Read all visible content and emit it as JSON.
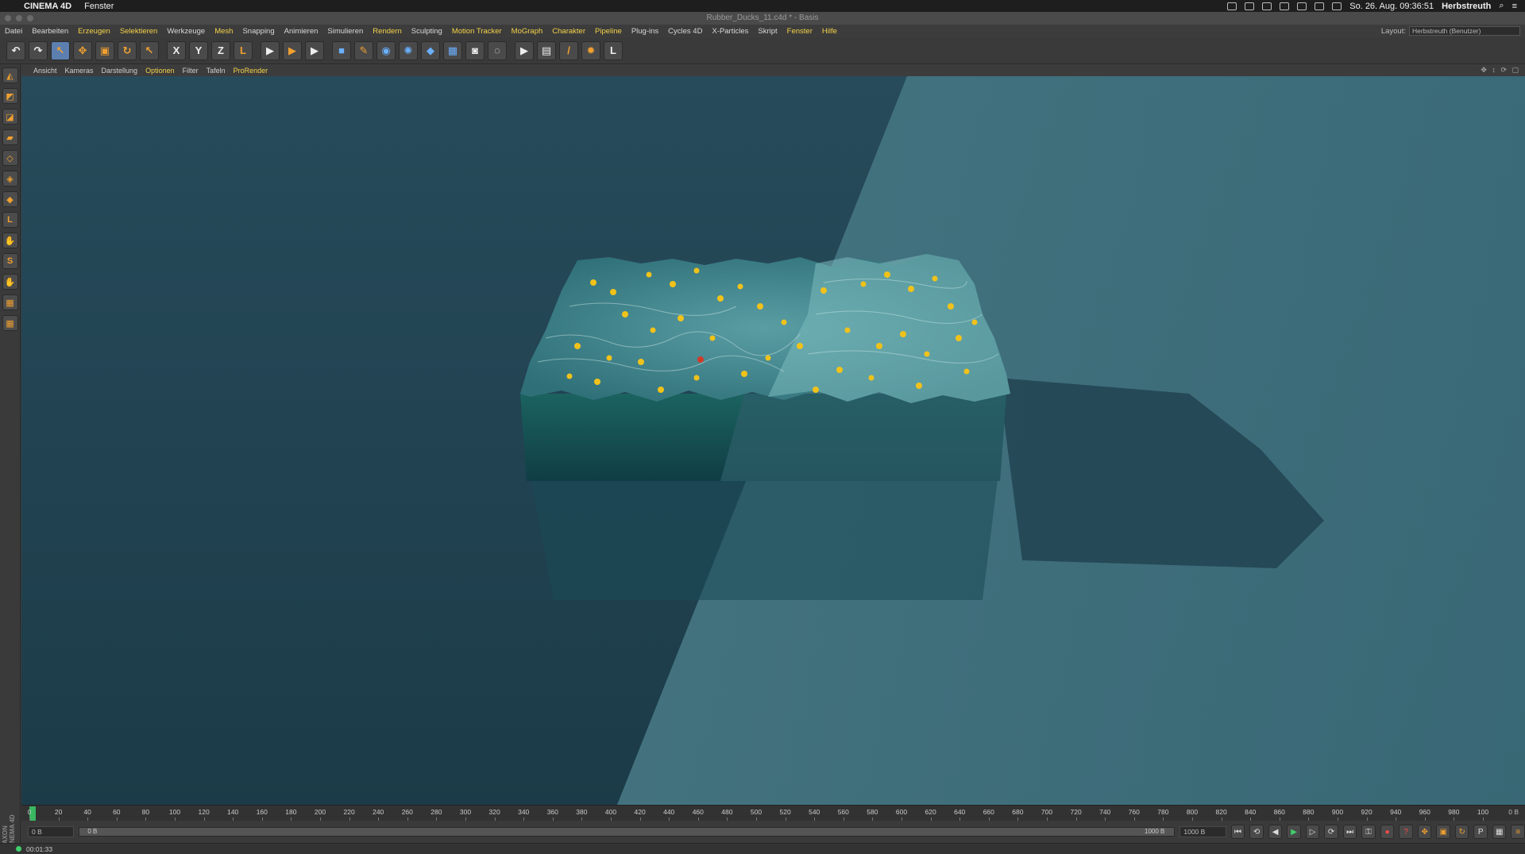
{
  "macbar": {
    "app_name": "CINEMA 4D",
    "menu": "Fenster",
    "clock": "So. 26. Aug. 09:36:51",
    "user": "Herbstreuth"
  },
  "window": {
    "title": "Rubber_Ducks_11.c4d * - Basis"
  },
  "main_menu": [
    {
      "label": "Datei",
      "hl": false
    },
    {
      "label": "Bearbeiten",
      "hl": false
    },
    {
      "label": "Erzeugen",
      "hl": true
    },
    {
      "label": "Selektieren",
      "hl": true
    },
    {
      "label": "Werkzeuge",
      "hl": false
    },
    {
      "label": "Mesh",
      "hl": true
    },
    {
      "label": "Snapping",
      "hl": false
    },
    {
      "label": "Animieren",
      "hl": false
    },
    {
      "label": "Simulieren",
      "hl": false
    },
    {
      "label": "Rendern",
      "hl": true
    },
    {
      "label": "Sculpting",
      "hl": false
    },
    {
      "label": "Motion Tracker",
      "hl": true
    },
    {
      "label": "MoGraph",
      "hl": true
    },
    {
      "label": "Charakter",
      "hl": true
    },
    {
      "label": "Pipeline",
      "hl": true
    },
    {
      "label": "Plug-ins",
      "hl": false
    },
    {
      "label": "Cycles 4D",
      "hl": false
    },
    {
      "label": "X-Particles",
      "hl": false
    },
    {
      "label": "Skript",
      "hl": false
    },
    {
      "label": "Fenster",
      "hl": true
    },
    {
      "label": "Hilfe",
      "hl": true
    }
  ],
  "layout": {
    "label": "Layout:",
    "value": "Herbstreuth (Benutzer)"
  },
  "toolbar": [
    {
      "name": "undo-icon",
      "glyph": "↶",
      "cls": ""
    },
    {
      "name": "redo-icon",
      "glyph": "↷",
      "cls": ""
    },
    {
      "name": "live-selection-icon",
      "glyph": "↖",
      "cls": "orange active"
    },
    {
      "name": "move-icon",
      "glyph": "✥",
      "cls": "orange"
    },
    {
      "name": "scale-icon",
      "glyph": "▣",
      "cls": "orange"
    },
    {
      "name": "rotate-icon",
      "glyph": "↻",
      "cls": "orange"
    },
    {
      "name": "recent-tool-icon",
      "glyph": "↖",
      "cls": "orange"
    },
    {
      "name": "x-axis-icon",
      "glyph": "X",
      "cls": "sep"
    },
    {
      "name": "y-axis-icon",
      "glyph": "Y",
      "cls": ""
    },
    {
      "name": "z-axis-icon",
      "glyph": "Z",
      "cls": ""
    },
    {
      "name": "coordinate-system-icon",
      "glyph": "L",
      "cls": "orange"
    },
    {
      "name": "render-view-icon",
      "glyph": "▶",
      "cls": "sep"
    },
    {
      "name": "render-picture-viewer-icon",
      "glyph": "▶",
      "cls": "orange"
    },
    {
      "name": "render-settings-icon",
      "glyph": "▶",
      "cls": ""
    },
    {
      "name": "cube-icon",
      "glyph": "■",
      "cls": "blue sep"
    },
    {
      "name": "pen-spline-icon",
      "glyph": "✎",
      "cls": "orange"
    },
    {
      "name": "subdivision-icon",
      "glyph": "◉",
      "cls": "blue"
    },
    {
      "name": "array-icon",
      "glyph": "✺",
      "cls": "blue"
    },
    {
      "name": "deformer-icon",
      "glyph": "◆",
      "cls": "blue"
    },
    {
      "name": "floor-icon",
      "glyph": "▦",
      "cls": "blue"
    },
    {
      "name": "camera-icon",
      "glyph": "◙",
      "cls": ""
    },
    {
      "name": "light-icon",
      "glyph": "◌",
      "cls": ""
    },
    {
      "name": "render-region-icon",
      "glyph": "▶",
      "cls": "sep"
    },
    {
      "name": "clapper-icon",
      "glyph": "▤",
      "cls": ""
    },
    {
      "name": "paint-icon",
      "glyph": "/",
      "cls": "orange"
    },
    {
      "name": "settings-gear-icon",
      "glyph": "✹",
      "cls": "orange"
    },
    {
      "name": "layer-icon",
      "glyph": "L",
      "cls": ""
    }
  ],
  "left_palette": [
    {
      "name": "make-editable-icon",
      "glyph": "◭"
    },
    {
      "name": "model-mode-icon",
      "glyph": "◩"
    },
    {
      "name": "texture-mode-icon",
      "glyph": "◪"
    },
    {
      "name": "workplane-icon",
      "glyph": "▰"
    },
    {
      "name": "points-mode-icon",
      "glyph": "◇"
    },
    {
      "name": "edges-mode-icon",
      "glyph": "◈"
    },
    {
      "name": "polygons-mode-icon",
      "glyph": "◆"
    },
    {
      "name": "axis-icon",
      "glyph": "L"
    },
    {
      "name": "tweak-icon",
      "glyph": "✋"
    },
    {
      "name": "snap-icon",
      "glyph": "S"
    },
    {
      "name": "locking-icon",
      "glyph": "✋"
    },
    {
      "name": "grid-icon",
      "glyph": "▦"
    },
    {
      "name": "workplane-lock-icon",
      "glyph": "▦"
    }
  ],
  "maxon_label": "MAXON CINEMA 4D",
  "view_menu": [
    {
      "label": "Ansicht",
      "hl": false
    },
    {
      "label": "Kameras",
      "hl": false
    },
    {
      "label": "Darstellung",
      "hl": false
    },
    {
      "label": "Optionen",
      "hl": true
    },
    {
      "label": "Filter",
      "hl": false
    },
    {
      "label": "Tafeln",
      "hl": false
    },
    {
      "label": "ProRender",
      "hl": true
    }
  ],
  "timeline": {
    "ticks": [
      "0",
      "20",
      "40",
      "60",
      "80",
      "100",
      "120",
      "140",
      "160",
      "180",
      "200",
      "220",
      "240",
      "260",
      "280",
      "300",
      "320",
      "340",
      "360",
      "380",
      "400",
      "420",
      "440",
      "460",
      "480",
      "500",
      "520",
      "540",
      "560",
      "580",
      "600",
      "620",
      "640",
      "660",
      "680",
      "700",
      "720",
      "740",
      "760",
      "780",
      "800",
      "820",
      "840",
      "860",
      "880",
      "900",
      "920",
      "940",
      "960",
      "980",
      "100"
    ],
    "end_field": "0 B"
  },
  "transport": {
    "current_frame": "0 B",
    "range_start": "0 B",
    "range_end": "1000 B",
    "max_frame": "1000 B"
  },
  "status": {
    "time": "00:01:33"
  },
  "colors": {
    "accent_menu": "#f5d34a",
    "play_green": "#3fd06b",
    "viewport_bg": "#20414f"
  }
}
